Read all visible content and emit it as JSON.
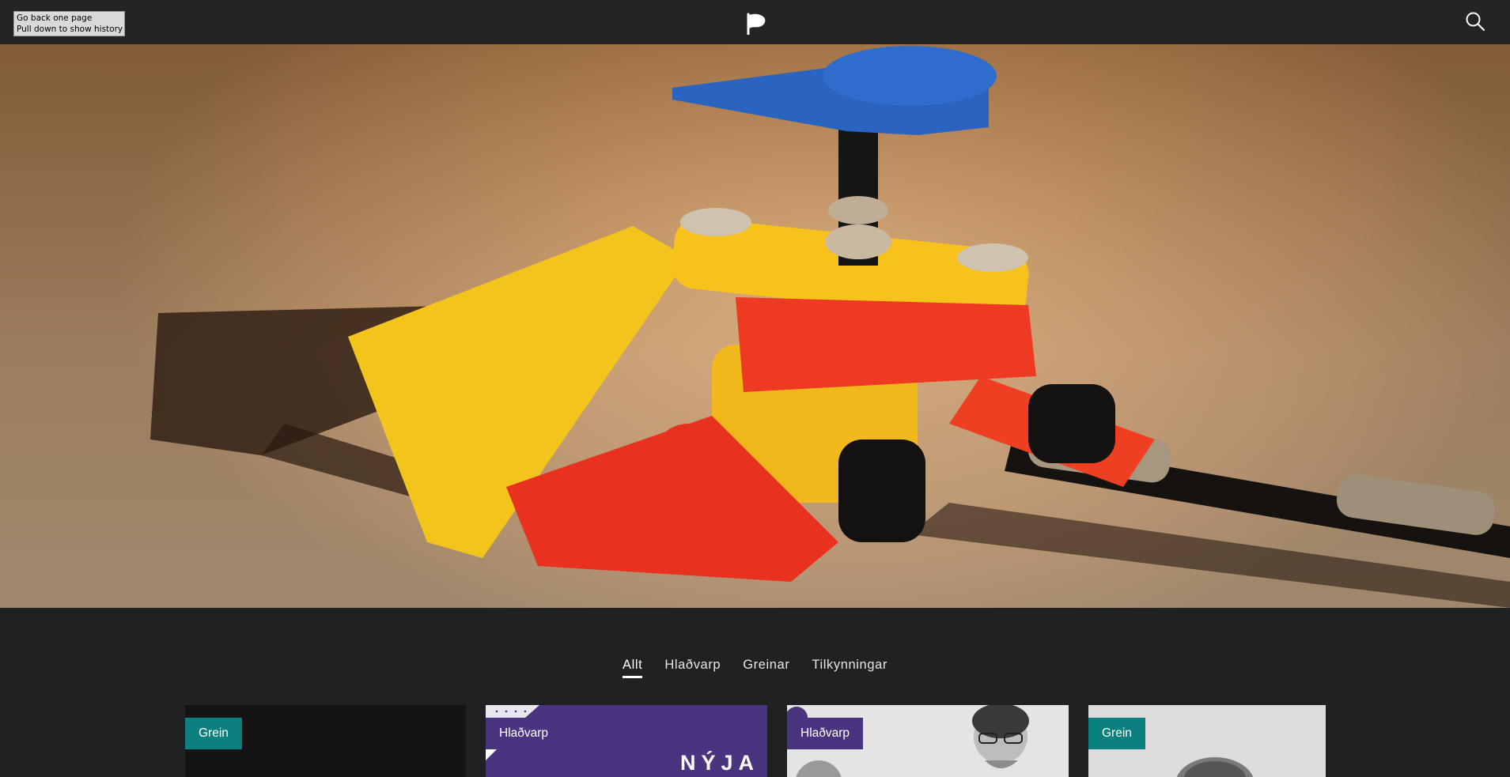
{
  "browser_tooltip": {
    "line1": "Go back one page",
    "line2": "Pull down to show history"
  },
  "header": {
    "logo_icon": "pirate-flag-logo-icon",
    "search_icon": "search-icon"
  },
  "hero": {
    "image": "lego-technic-model-photo"
  },
  "filters": {
    "tabs": [
      {
        "label": "Allt",
        "active": true
      },
      {
        "label": "Hlaðvarp",
        "active": false
      },
      {
        "label": "Greinar",
        "active": false
      },
      {
        "label": "Tilkynningar",
        "active": false
      }
    ]
  },
  "cards": [
    {
      "badge": "Grein",
      "badge_color": "#0c7f7f",
      "background": "#141414"
    },
    {
      "badge": "Hlaðvarp",
      "badge_color": "#4b347f",
      "background": "#4b347f",
      "cover_text": "NÝJA"
    },
    {
      "badge": "Hlaðvarp",
      "badge_color": "#4b347f",
      "background": "#bdbdbd"
    },
    {
      "badge": "Grein",
      "badge_color": "#0c7f7f",
      "background": "#cfcfcf"
    }
  ]
}
